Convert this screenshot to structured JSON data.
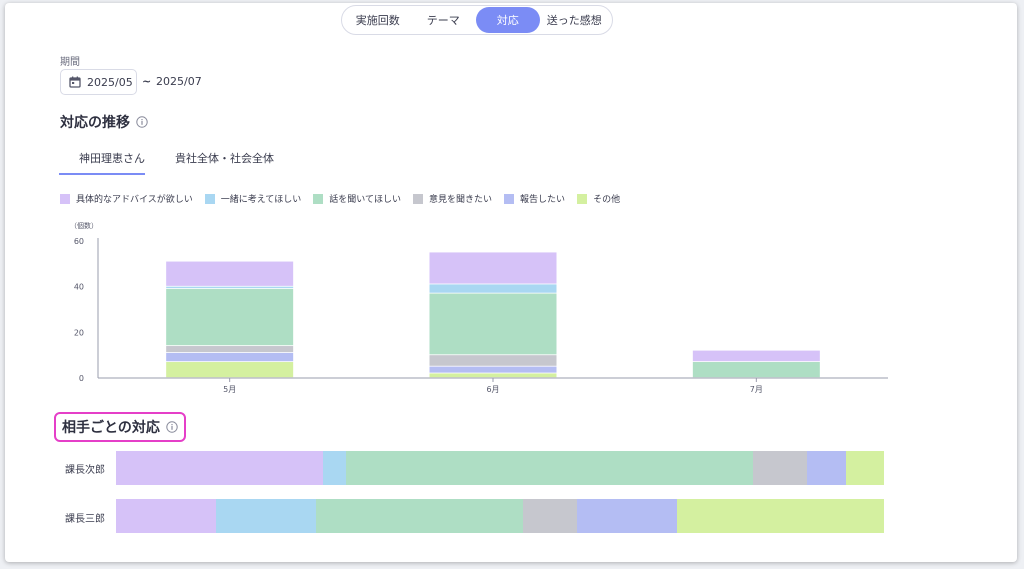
{
  "top_tabs": [
    {
      "label": "実施回数",
      "active": false
    },
    {
      "label": "テーマ",
      "active": false
    },
    {
      "label": "対応",
      "active": true
    },
    {
      "label": "送った感想",
      "active": false
    }
  ],
  "period": {
    "label": "期間",
    "start": "2025/05",
    "separator": "~",
    "end": "2025/07"
  },
  "trend": {
    "title": "対応の推移"
  },
  "sub_tabs": [
    {
      "label": "神田理恵さん",
      "active": true
    },
    {
      "label": "貴社全体・社会全体",
      "active": false
    }
  ],
  "legend": [
    {
      "label": "具体的なアドバイスが欲しい",
      "color": "#d6c2f8"
    },
    {
      "label": "一緒に考えてほしい",
      "color": "#a9d7f2"
    },
    {
      "label": "話を聞いてほしい",
      "color": "#aedec4"
    },
    {
      "label": "意見を聞きたい",
      "color": "#c6c7ce"
    },
    {
      "label": "報告したい",
      "color": "#b4bdf3"
    },
    {
      "label": "その他",
      "color": "#d4f0a0"
    }
  ],
  "chart_data": {
    "type": "bar",
    "stacked": true,
    "ylabel": "（個数）",
    "ylim": [
      0,
      60
    ],
    "yticks": [
      0,
      20,
      40,
      60
    ],
    "categories": [
      "5月",
      "6月",
      "7月"
    ],
    "series": [
      {
        "name": "その他",
        "color": "#d4f0a0",
        "values": [
          7,
          2,
          0
        ]
      },
      {
        "name": "報告したい",
        "color": "#b4bdf3",
        "values": [
          4,
          3,
          0
        ]
      },
      {
        "name": "意見を聞きたい",
        "color": "#c6c7ce",
        "values": [
          3,
          5,
          0
        ]
      },
      {
        "name": "話を聞いてほしい",
        "color": "#aedec4",
        "values": [
          25,
          27,
          7
        ]
      },
      {
        "name": "一緒に考えてほしい",
        "color": "#a9d7f2",
        "values": [
          1,
          4,
          0
        ]
      },
      {
        "name": "具体的なアドバイスが欲しい",
        "color": "#d6c2f8",
        "values": [
          11,
          14,
          5
        ]
      }
    ]
  },
  "partners": {
    "title": "相手ごとの対応",
    "rows": [
      {
        "label": "課長次郎",
        "shares": [
          27,
          3,
          53,
          7,
          5,
          5
        ]
      },
      {
        "label": "課長三郎",
        "shares": [
          13,
          13,
          27,
          7,
          13,
          27
        ]
      }
    ]
  }
}
